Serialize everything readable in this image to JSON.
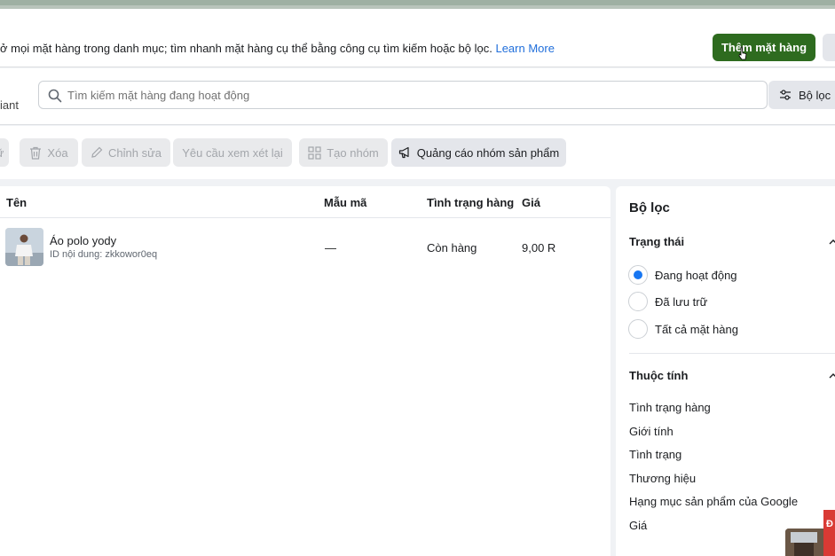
{
  "header": {
    "description": "ở mọi mặt hàng trong danh mục; tìm nhanh mặt hàng cụ thể bằng công cụ tìm kiếm hoặc bộ lọc.",
    "learn_more": "Learn More",
    "add_button": "Thêm mặt hàng"
  },
  "search": {
    "left_label": "iant",
    "placeholder": "Tìm kiếm mặt hàng đang hoạt động",
    "filter_button": "Bộ lọc"
  },
  "toolbar": {
    "partial_label": "ữ",
    "delete": "Xóa",
    "edit": "Chỉnh sửa",
    "review": "Yêu cầu xem xét lại",
    "create_group": "Tạo nhóm",
    "advertise": "Quảng cáo nhóm sản phẩm"
  },
  "table": {
    "headers": {
      "name": "Tên",
      "model": "Mẫu mã",
      "availability": "Tình trạng hàng",
      "price": "Giá"
    },
    "rows": [
      {
        "name": "Áo polo yody",
        "content_id": "ID nội dung: zkkowor0eq",
        "model": "—",
        "availability": "Còn hàng",
        "price": "9,00 R"
      }
    ]
  },
  "filters": {
    "title": "Bộ lọc",
    "status": {
      "title": "Trạng thái",
      "options": [
        "Đang hoạt động",
        "Đã lưu trữ",
        "Tất cả mặt hàng"
      ],
      "selected": 0
    },
    "attributes": {
      "title": "Thuộc tính",
      "items": [
        "Tình trạng hàng",
        "Giới tính",
        "Tình trạng",
        "Thương hiệu",
        "Hạng mục sản phẩm của Google",
        "Giá"
      ]
    }
  },
  "overlay": {
    "red_tag": "Đ"
  },
  "colors": {
    "primary_green": "#2e6b1f",
    "link_blue": "#216fdb",
    "radio_blue": "#1877f2"
  }
}
